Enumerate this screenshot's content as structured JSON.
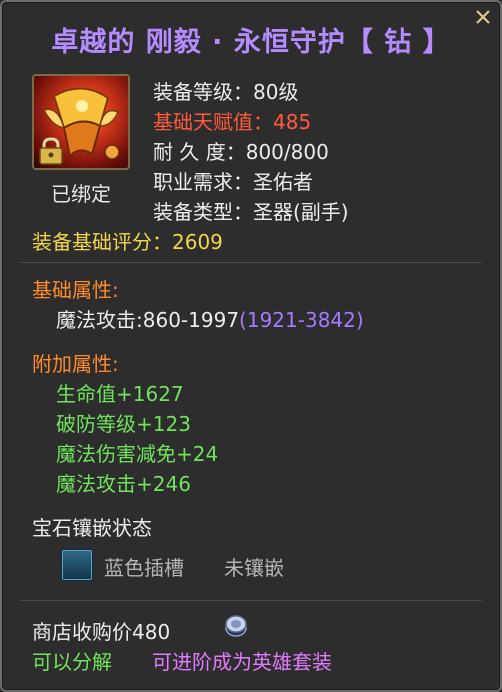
{
  "title": "卓越的 刚毅 · 永恒守护【 钻 】",
  "item": {
    "icon": "winged-helm-offhand-icon",
    "lock_icon": "lock-icon",
    "bound_label": "已绑定"
  },
  "stats": {
    "equip_level": "装备等级：80级",
    "base_talent_label": "基础天赋值：",
    "base_talent_value": "485",
    "durability": "耐 久 度：800/800",
    "class_req": "职业需求：圣佑者",
    "equip_type": "装备类型：圣器(副手)",
    "score_label": "装备基础评分：",
    "score_value": "2609"
  },
  "base_attr": {
    "header": "基础属性:",
    "magic_attack_label": "魔法攻击:",
    "magic_attack_value": "860-1997",
    "magic_attack_range": "(1921-3842)"
  },
  "extra_attr": {
    "header": "附加属性:",
    "items": [
      "生命值+1627",
      "破防等级+123",
      "魔法伤害减免+24",
      "魔法攻击+246"
    ]
  },
  "gems": {
    "header": "宝石镶嵌状态",
    "slot_label": "蓝色插槽",
    "slot_status": "未镶嵌"
  },
  "footer": {
    "shop_price": "商店收购价480",
    "decompose": "可以分解",
    "upgrade": "可进阶成为英雄套装"
  },
  "colors": {
    "title": "#b58cff",
    "red": "#ff5a3c",
    "yellow": "#f2d64b",
    "orange": "#ff8a2a",
    "green": "#6fe35b",
    "purple": "#a57bff"
  }
}
